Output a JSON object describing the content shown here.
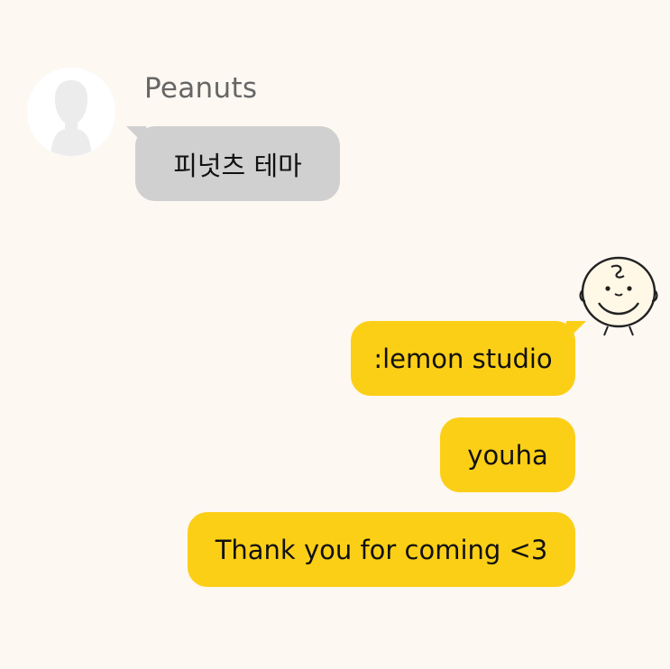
{
  "chat": {
    "sender": {
      "name": "Peanuts",
      "avatar_icon": "default-person-avatar"
    },
    "incoming": [
      {
        "text": "피넛츠 테마"
      }
    ],
    "outgoing": [
      {
        "text": ":lemon studio"
      },
      {
        "text": "youha"
      },
      {
        "text": "Thank you for coming <3"
      }
    ],
    "sticker_icon": "charlie-brown-face"
  },
  "colors": {
    "background": "#fdf8f2",
    "incoming_bubble": "#d0d0d0",
    "outgoing_bubble": "#fccf17",
    "sender_name": "#666666"
  }
}
